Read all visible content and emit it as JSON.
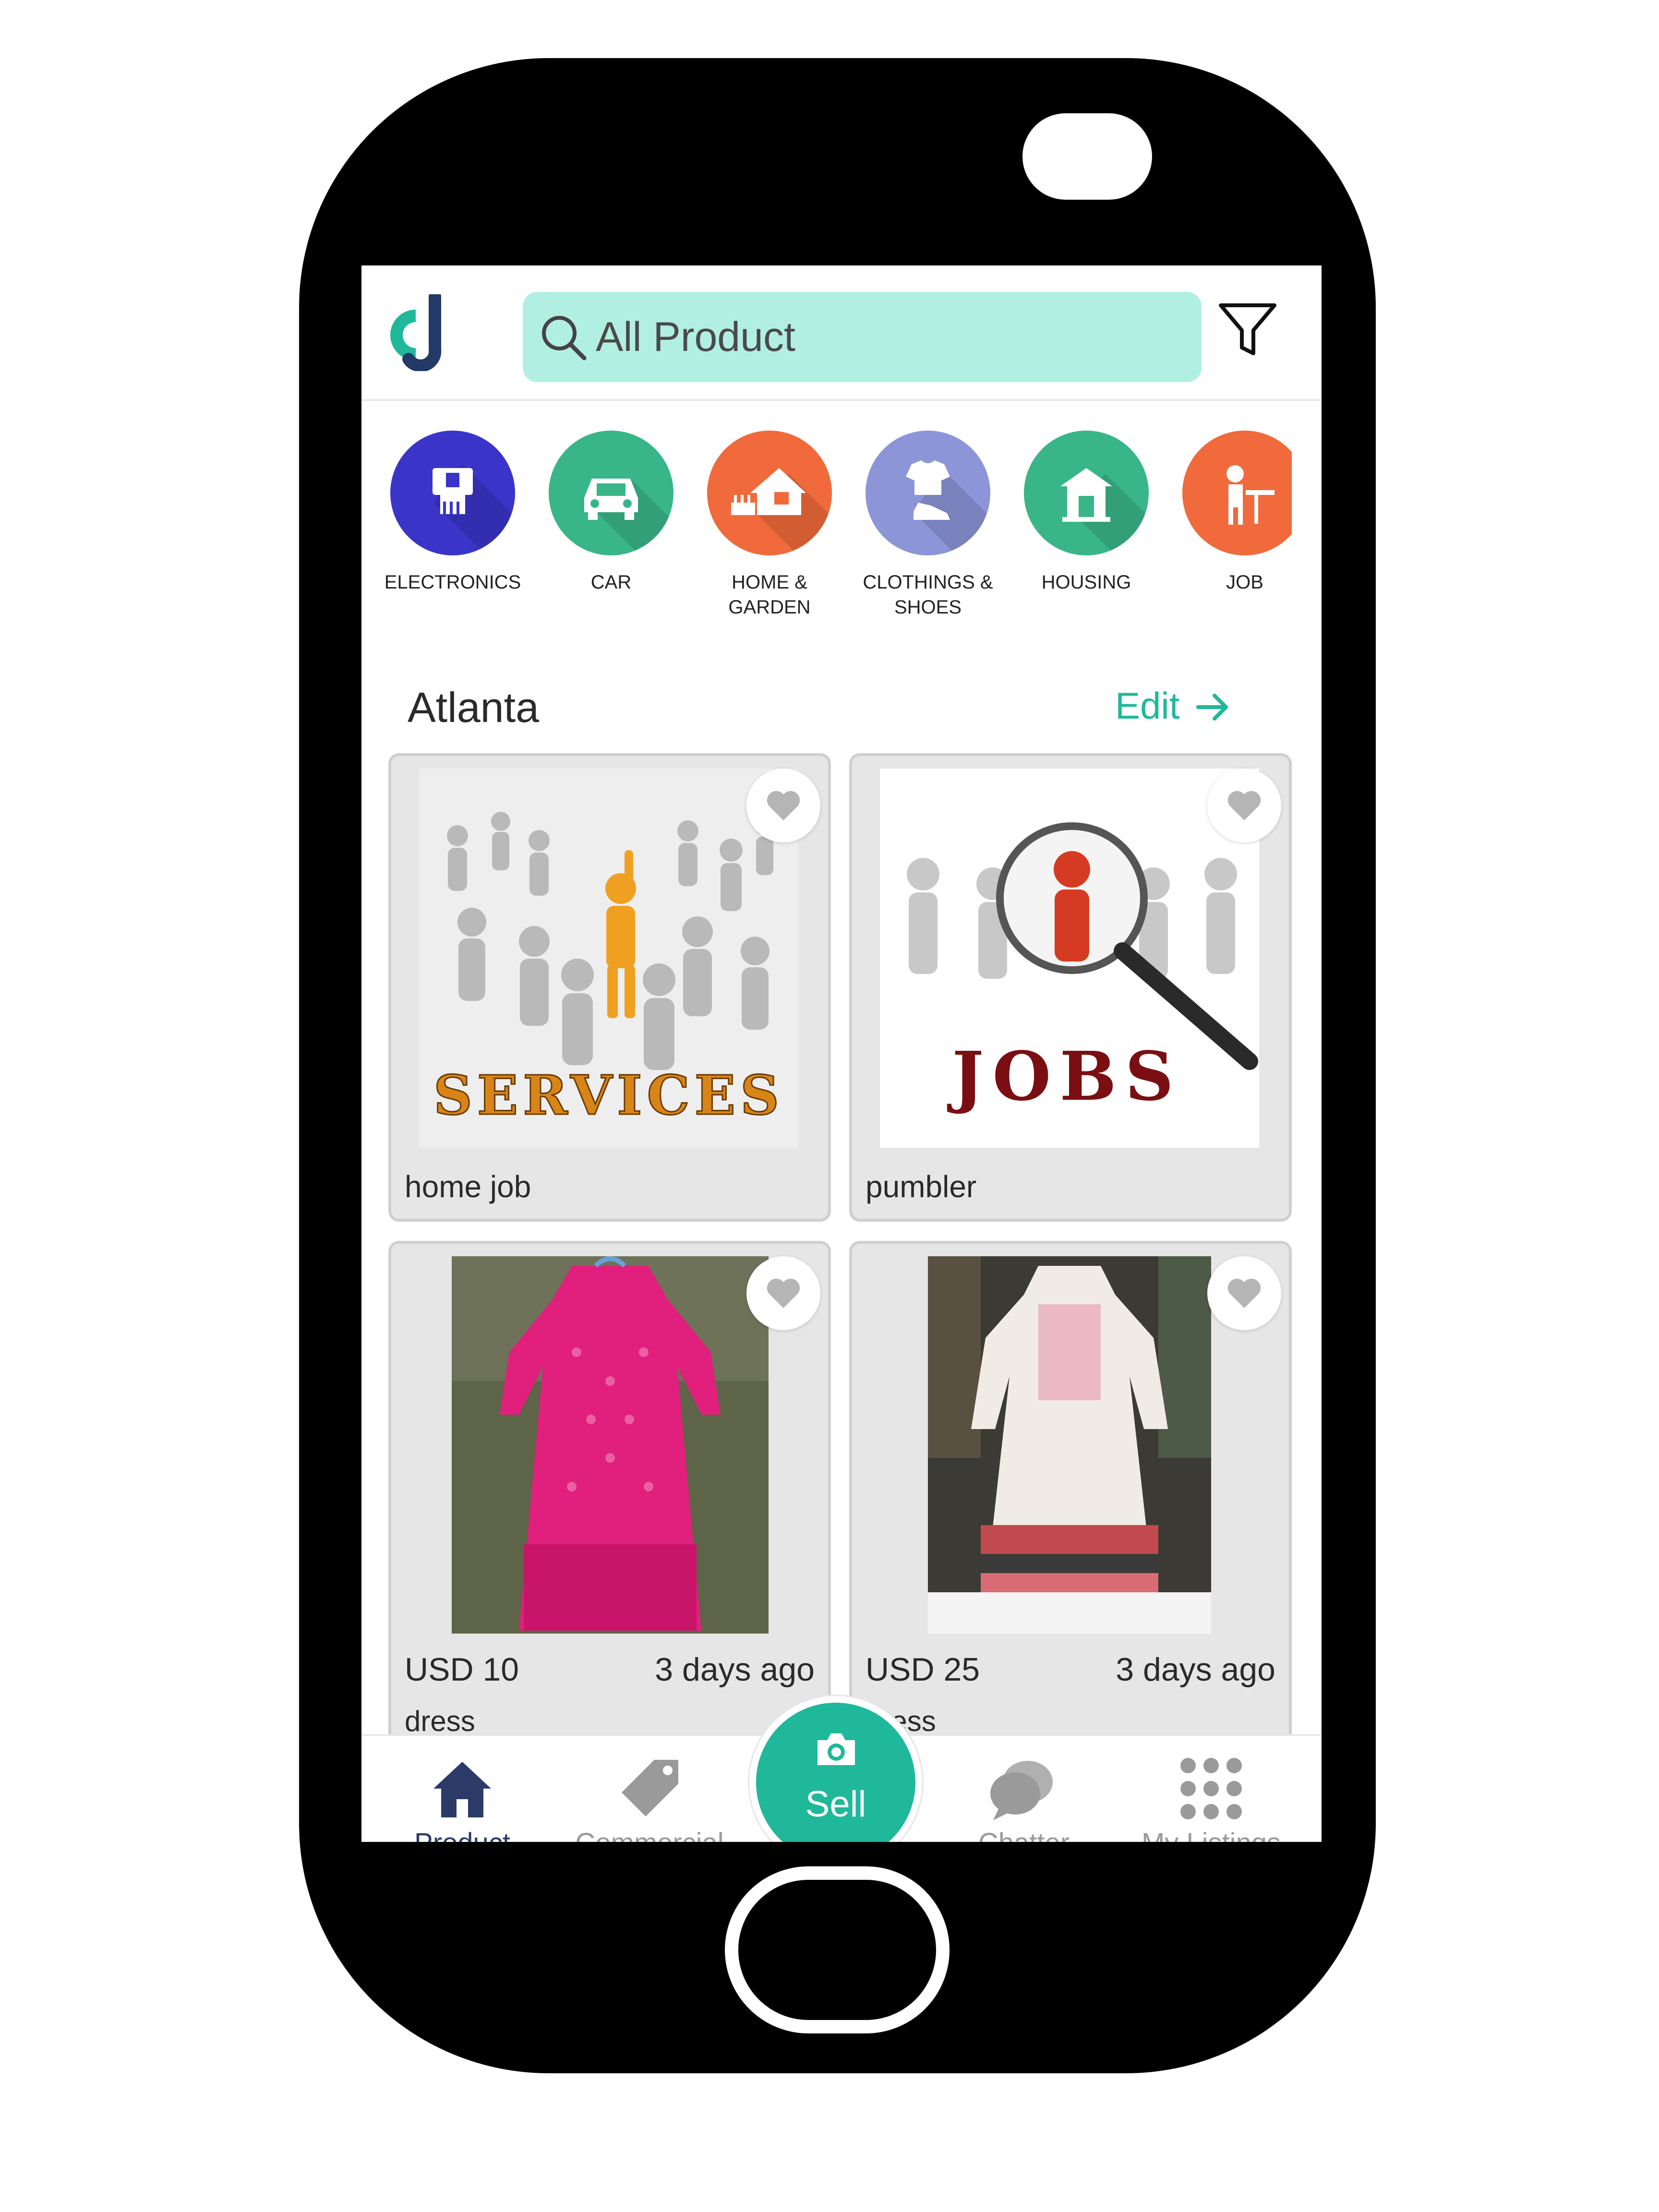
{
  "search": {
    "placeholder": "All Product"
  },
  "categories": [
    {
      "label": "ELECTRONICS",
      "color": "#3a35c8",
      "icon": "electronics-icon"
    },
    {
      "label": "CAR",
      "color": "#39b58a",
      "icon": "car-icon"
    },
    {
      "label": "HOME & GARDEN",
      "color": "#f06a3b",
      "icon": "home-garden-icon"
    },
    {
      "label": "CLOTHINGS & SHOES",
      "color": "#8b95d8",
      "icon": "clothing-icon"
    },
    {
      "label": "HOUSING",
      "color": "#39b58a",
      "icon": "housing-icon"
    },
    {
      "label": "JOB",
      "color": "#f06a3b",
      "icon": "job-icon"
    }
  ],
  "location": {
    "name": "Atlanta",
    "edit_label": "Edit"
  },
  "listings": [
    {
      "title": "home job",
      "image_text": "SERVICES"
    },
    {
      "title": "pumbler",
      "image_text": "JOBS"
    },
    {
      "price": "USD 10",
      "ago": "3 days ago",
      "title": "dress"
    },
    {
      "price": "USD 25",
      "ago": "3 days ago",
      "title": "dress"
    }
  ],
  "nav": {
    "product": "Product",
    "commercial": "Commercial",
    "sell": "Sell",
    "chatter": "Chatter",
    "my_listings": "My Listings"
  },
  "colors": {
    "accent": "#1fb89a",
    "search_bg": "#b2efe3",
    "nav_active": "#2b3a67"
  }
}
